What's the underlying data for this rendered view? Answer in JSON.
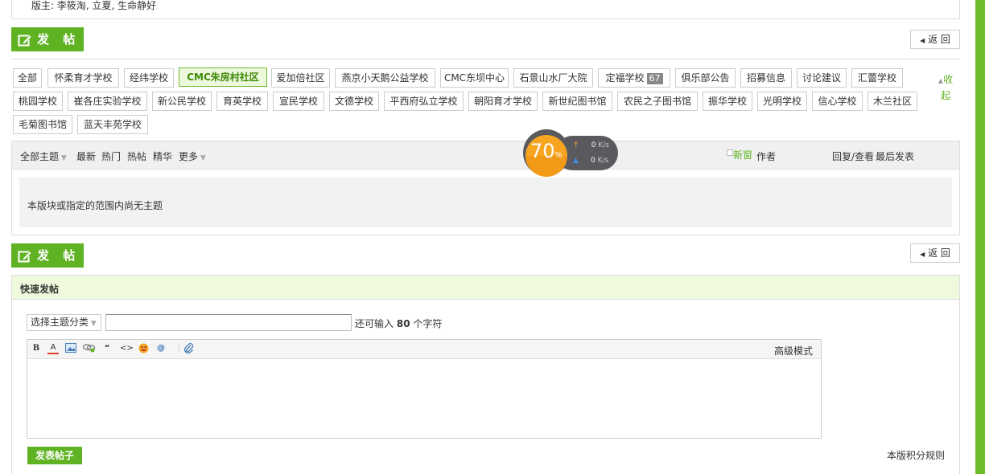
{
  "moderators": "版主: 李筱淘, 立夏, 生命静好",
  "post_button": "发 帖",
  "back_button": "返 回",
  "forum_tags": [
    {
      "label": "全部"
    },
    {
      "label": "怀柔育才学校"
    },
    {
      "label": "经纬学校"
    },
    {
      "label": "CMC朱房村社区",
      "active": true
    },
    {
      "label": "爱加倍社区"
    },
    {
      "label": "燕京小天鹅公益学校"
    },
    {
      "label": "CMC东坝中心"
    },
    {
      "label": "石景山水厂大院"
    },
    {
      "label": "定福学校",
      "badge": "67"
    },
    {
      "label": "俱乐部公告"
    },
    {
      "label": "招募信息"
    },
    {
      "label": "讨论建议"
    },
    {
      "label": "汇蕾学校"
    },
    {
      "label": "桃园学校"
    },
    {
      "label": "崔各庄实验学校"
    },
    {
      "label": "新公民学校"
    },
    {
      "label": "育英学校"
    },
    {
      "label": "宣民学校"
    },
    {
      "label": "文德学校"
    },
    {
      "label": "平西府弘立学校"
    },
    {
      "label": "朝阳育才学校"
    },
    {
      "label": "新世纪图书馆"
    },
    {
      "label": "农民之子图书馆"
    },
    {
      "label": "振华学校"
    },
    {
      "label": "光明学校"
    },
    {
      "label": "信心学校"
    },
    {
      "label": "木兰社区"
    },
    {
      "label": "毛菊图书馆"
    },
    {
      "label": "蓝天丰苑学校"
    }
  ],
  "collapse": {
    "line1": "收",
    "line2": "起"
  },
  "thread_filters": {
    "all": "全部主题",
    "newest": "最新",
    "hot": "热门",
    "hot_posts": "热帖",
    "digest": "精华",
    "more": "更多",
    "new_window": "新窗",
    "author": "作者",
    "reply_view": "回复/查看",
    "last_post": "最后发表"
  },
  "empty_message": "本版块或指定的范围内尚无主题",
  "speed_widget": {
    "percent": "70",
    "percent_sign": "%",
    "up": "0",
    "down": "0",
    "unit": "K/s"
  },
  "quick_post": {
    "title": "快速发帖",
    "category_select": "选择主题分类",
    "char_prefix": "还可输入",
    "char_count": "80",
    "char_suffix": "个字符",
    "advanced_mode": "高级模式",
    "submit": "发表帖子",
    "rules_link": "本版积分规则"
  },
  "colors": {
    "accent": "#5fb323",
    "quick_post_header": "#effadd"
  }
}
